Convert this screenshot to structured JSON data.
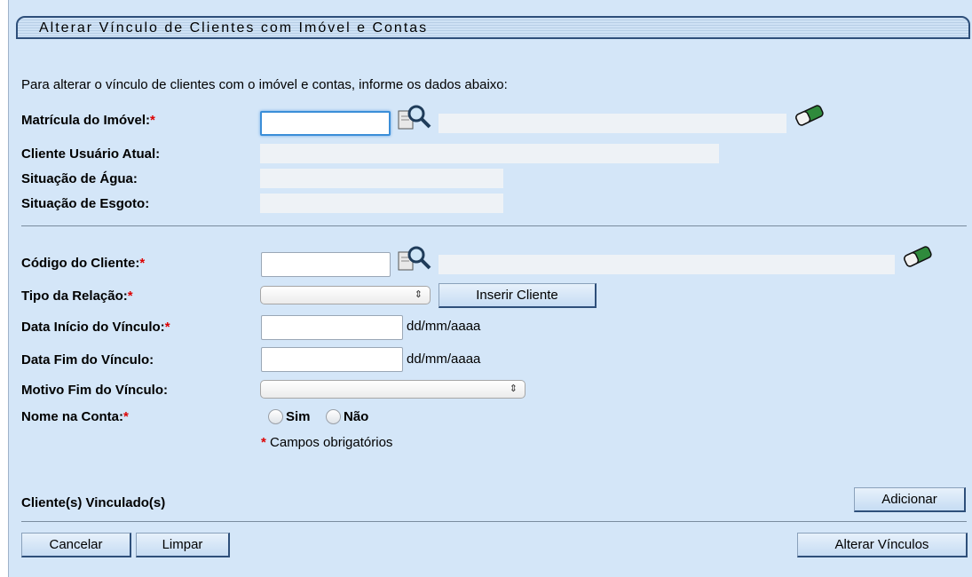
{
  "title": "Alterar Vínculo de Clientes com Imóvel e Contas",
  "instructions": "Para alterar o vínculo de clientes com o imóvel e contas, informe os dados abaixo:",
  "imovel": {
    "matricula_label": "Matrícula do Imóvel:",
    "cliente_usuario_label": "Cliente Usuário Atual:",
    "situacao_agua_label": "Situação de Água:",
    "situacao_esgoto_label": "Situação de Esgoto:"
  },
  "cliente": {
    "codigo_label": "Código do Cliente:",
    "tipo_relacao_label": "Tipo da Relação:",
    "inserir_button": "Inserir Cliente",
    "data_inicio_label": "Data Início do Vínculo:",
    "data_fim_label": "Data Fim do Vínculo:",
    "date_hint": "dd/mm/aaaa",
    "motivo_label": "Motivo Fim do Vínculo:",
    "nome_conta_label": "Nome na Conta:",
    "sim": "Sim",
    "nao": "Não",
    "required_note": "Campos obrigatórios"
  },
  "required_marker": "*",
  "vinculados_label": "Cliente(s) Vinculado(s)",
  "buttons": {
    "adicionar": "Adicionar",
    "cancelar": "Cancelar",
    "limpar": "Limpar",
    "alterar": "Alterar Vínculos"
  },
  "icons": {
    "search": "magnifier-search-icon",
    "eraser": "eraser-icon"
  },
  "colors": {
    "background": "#d4e6f8",
    "required": "#dd0000",
    "title_border": "#2e4f7a"
  }
}
